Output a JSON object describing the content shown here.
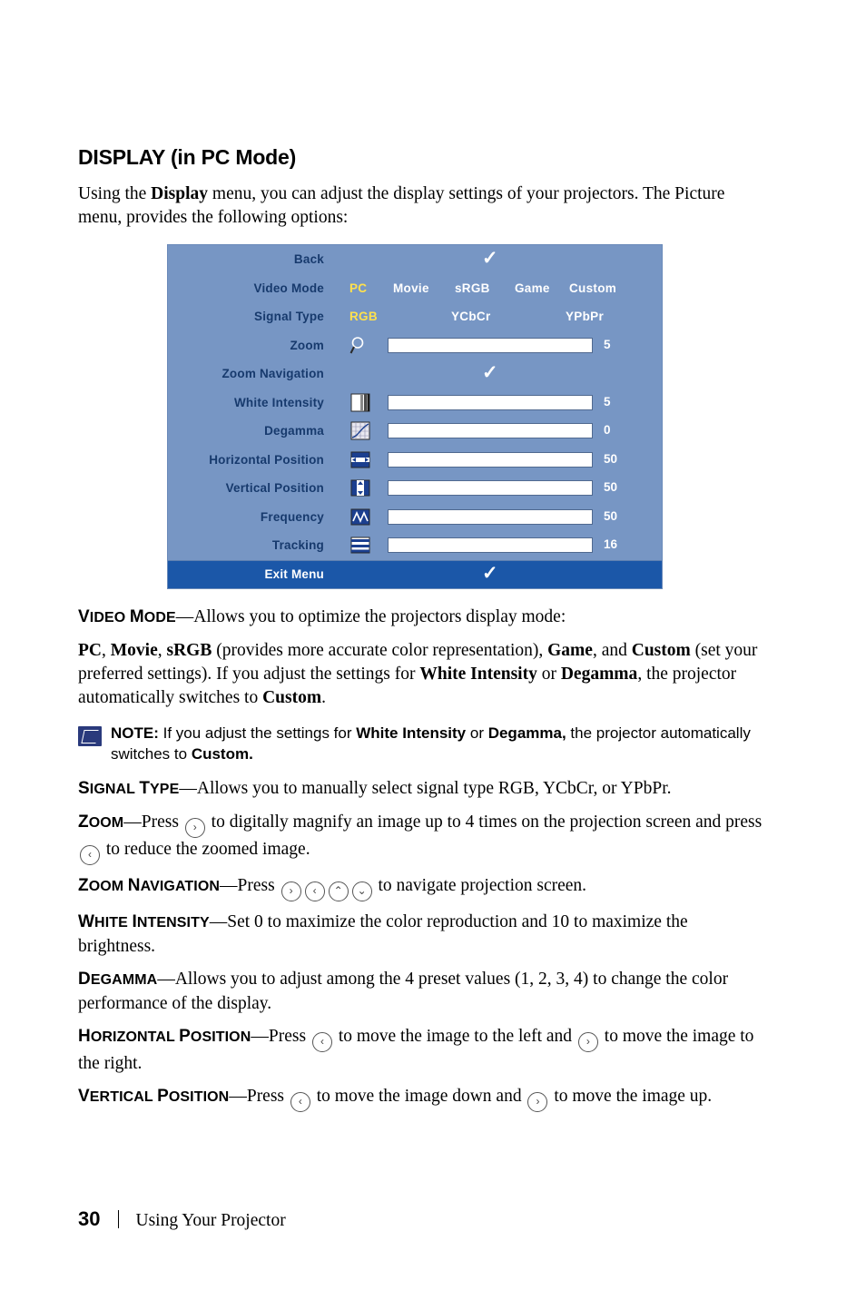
{
  "page": {
    "title": "DISPLAY (in PC Mode)",
    "intro_line1_a": "Using the ",
    "intro_line1_b": "Display",
    "intro_line1_c": " menu, you can adjust the display settings of your projectors.",
    "intro_line2": "The Picture menu, provides the following options:"
  },
  "osd": {
    "rows": [
      {
        "label": "Back",
        "type": "check"
      },
      {
        "label": "Video Mode",
        "type": "options"
      },
      {
        "label": "Signal Type",
        "type": "options"
      },
      {
        "label": "Zoom",
        "type": "slider",
        "value": "5",
        "fill": 46,
        "icon": "magnifier-icon"
      },
      {
        "label": "Zoom Navigation",
        "type": "check"
      },
      {
        "label": "White Intensity",
        "type": "slider",
        "value": "5",
        "fill": 46,
        "icon": "white-intensity-icon"
      },
      {
        "label": "Degamma",
        "type": "slider",
        "value": "0",
        "fill": 46,
        "icon": "degamma-icon"
      },
      {
        "label": "Horizontal Position",
        "type": "slider",
        "value": "50",
        "fill": 46,
        "icon": "horizontal-position-icon"
      },
      {
        "label": "Vertical Position",
        "type": "slider",
        "value": "50",
        "fill": 46,
        "icon": "vertical-position-icon"
      },
      {
        "label": "Frequency",
        "type": "slider",
        "value": "50",
        "fill": 46,
        "icon": "frequency-icon"
      },
      {
        "label": "Tracking",
        "type": "slider",
        "value": "16",
        "fill": 46,
        "icon": "tracking-icon"
      }
    ],
    "video_mode_options": [
      "PC",
      "Movie",
      "sRGB",
      "Game",
      "Custom"
    ],
    "video_mode_selected": "PC",
    "signal_type_options": [
      "RGB",
      "YCbCr",
      "YPbPr"
    ],
    "signal_type_selected": "RGB",
    "exit_label": "Exit Menu",
    "check_glyph": "✓",
    "selected_color": "#ffe14d",
    "panel_color": "#7796c4",
    "label_color": "#173a6d",
    "exit_bar_color": "#1b57a8"
  },
  "sections": {
    "video_mode": {
      "head_cap": "V",
      "head_rest": "IDEO ",
      "head_cap2": "M",
      "head_rest2": "ODE",
      "dash": "—",
      "text": "Allows you to optimize the projectors display mode:",
      "para_1": "PC",
      "para_2": ", ",
      "para_3": "Movie",
      "para_4": ", ",
      "para_5": "sRGB",
      "para_6": " (provides more accurate color representation), ",
      "para_7": "Game",
      "para_8": ", and ",
      "para_9": "Custom",
      "para_10": " (set your preferred settings). If you adjust the settings for ",
      "para_11": "White Intensity",
      "para_12": " or ",
      "para_13": "Degamma",
      "para_14": ", the projector automatically switches to ",
      "para_15": "Custom",
      "para_16": "."
    },
    "note": {
      "label": "NOTE:",
      "t1": " If you adjust the settings for ",
      "b1": "White Intensity",
      "t2": " or ",
      "b2": "Degamma,",
      "t3": " the projector automatically switches to ",
      "b3": "Custom."
    },
    "signal_type": {
      "head_cap": "S",
      "head_rest": "IGNAL ",
      "head_cap2": "T",
      "head_rest2": "YPE",
      "dash": "—",
      "text": "Allows you to manually select signal type RGB, YCbCr, or YPbPr."
    },
    "zoom": {
      "head_cap": "Z",
      "head_rest": "OOM",
      "dash": "—",
      "t1": "Press ",
      "key1": "›",
      "t2": " to digitally magnify an image up to 4 times on the projection",
      "t3": "screen and press ",
      "key2": "‹",
      "t4": " to reduce the zoomed image."
    },
    "zoom_navigation": {
      "head_cap": "Z",
      "head_rest": "OOM ",
      "head_cap2": "N",
      "head_rest2": "AVIGATION",
      "dash": "—",
      "t1": "Press ",
      "key1": "›",
      "key2": "‹",
      "key3": "⌃",
      "key4": "⌄",
      "t2": " to navigate projection screen."
    },
    "white_intensity": {
      "head_cap": "W",
      "head_rest": "HITE ",
      "head_cap2": "I",
      "head_rest2": "NTENSITY",
      "dash": "—",
      "t1": "Set 0 to maximize the color reproduction and 10 to maximize",
      "t2": "the brightness."
    },
    "degamma": {
      "head_cap": "D",
      "head_rest": "EGAMMA",
      "dash": "—",
      "t1": "Allows you to adjust among the 4 preset values (1, 2, 3, 4) to change",
      "t2": "the color performance of the display."
    },
    "horizontal_position": {
      "head_cap": "H",
      "head_rest": "ORIZONTAL ",
      "head_cap2": "P",
      "head_rest2": "OSITION",
      "dash": "—",
      "t1": "Press ",
      "key1": "‹",
      "t2": " to move the image to the left and ",
      "key2": "›",
      "t3": " to move the",
      "t4": "image to the right."
    },
    "vertical_position": {
      "head_cap": "V",
      "head_rest": "ERTICAL ",
      "head_cap2": "P",
      "head_rest2": "OSITION",
      "dash": "—",
      "t1": "Press ",
      "key1": "‹",
      "t2": " to move the image down and ",
      "key2": "›",
      "t3": " to move the image up."
    }
  },
  "footer": {
    "page_number": "30",
    "text": "Using Your Projector"
  }
}
